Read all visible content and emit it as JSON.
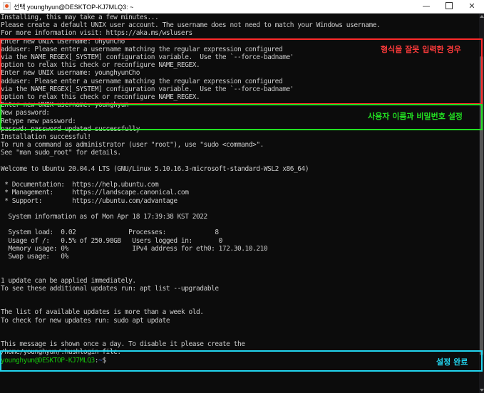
{
  "window": {
    "title": "선택 younghyun@DESKTOP-KJ7MLQ3: ~",
    "minimize_glyph": "—",
    "close_glyph": "✕"
  },
  "terminal": {
    "lines": [
      {
        "text": "Installing, this may take a few minutes..."
      },
      {
        "text": "Please create a default UNIX user account. The username does not need to match your Windows username."
      },
      {
        "text": "For more information visit: https://aka.ms/wslusers"
      },
      {
        "text": "Enter new UNIX username: OhyunCho"
      },
      {
        "text": "adduser: Please enter a username matching the regular expression configured"
      },
      {
        "text": "via the NAME_REGEX[_SYSTEM] configuration variable.  Use the `--force-badname'"
      },
      {
        "text": "option to relax this check or reconfigure NAME_REGEX."
      },
      {
        "text": "Enter new UNIX username: younghyunCho"
      },
      {
        "text": "adduser: Please enter a username matching the regular expression configured"
      },
      {
        "text": "via the NAME_REGEX[_SYSTEM] configuration variable.  Use the `--force-badname'"
      },
      {
        "text": "option to relax this check or reconfigure NAME_REGEX."
      },
      {
        "text": "Enter new UNIX username: younghyun"
      },
      {
        "text": "New password:"
      },
      {
        "text": "Retype new password:"
      },
      {
        "text": "passwd: password updated successfully"
      },
      {
        "text": "Installation successful!"
      },
      {
        "text": "To run a command as administrator (user \"root\"), use \"sudo <command>\"."
      },
      {
        "text": "See \"man sudo_root\" for details."
      },
      {
        "text": ""
      },
      {
        "text": "Welcome to Ubuntu 20.04.4 LTS (GNU/Linux 5.10.16.3-microsoft-standard-WSL2 x86_64)"
      },
      {
        "text": ""
      },
      {
        "text": " * Documentation:  https://help.ubuntu.com"
      },
      {
        "text": " * Management:     https://landscape.canonical.com"
      },
      {
        "text": " * Support:        https://ubuntu.com/advantage"
      },
      {
        "text": ""
      },
      {
        "text": "  System information as of Mon Apr 18 17:39:38 KST 2022"
      },
      {
        "text": ""
      },
      {
        "text": "  System load:  0.02              Processes:             8"
      },
      {
        "text": "  Usage of /:   0.5% of 250.98GB   Users logged in:       0"
      },
      {
        "text": "  Memory usage: 0%                 IPv4 address for eth0: 172.30.10.210"
      },
      {
        "text": "  Swap usage:   0%"
      },
      {
        "text": ""
      },
      {
        "text": ""
      },
      {
        "text": "1 update can be applied immediately."
      },
      {
        "text": "To see these additional updates run: apt list --upgradable"
      },
      {
        "text": ""
      },
      {
        "text": ""
      },
      {
        "text": "The list of available updates is more than a week old."
      },
      {
        "text": "To check for new updates run: sudo apt update"
      },
      {
        "text": ""
      },
      {
        "text": ""
      },
      {
        "text": "This message is shown once a day. To disable it please create the"
      },
      {
        "text": "/home/younghyun/.hushlogin file."
      }
    ],
    "prompt": {
      "user_host": "younghyun@DESKTOP-KJ7MLQ3",
      "separator": ":",
      "path": "~",
      "symbol": "$"
    },
    "colors": {
      "background": "#0c0c0c",
      "text": "#cccccc",
      "prompt_user": "#16c60c",
      "prompt_path": "#3b78ff"
    }
  },
  "annotations": {
    "red": {
      "label": "형식을 잘못 입력한 경우",
      "color": "#ff2a2a"
    },
    "green": {
      "label": "사용자 이름과 비밀번호 설정",
      "color": "#22e022"
    },
    "cyan": {
      "label": "설정 완료",
      "color": "#22d6f0"
    }
  }
}
